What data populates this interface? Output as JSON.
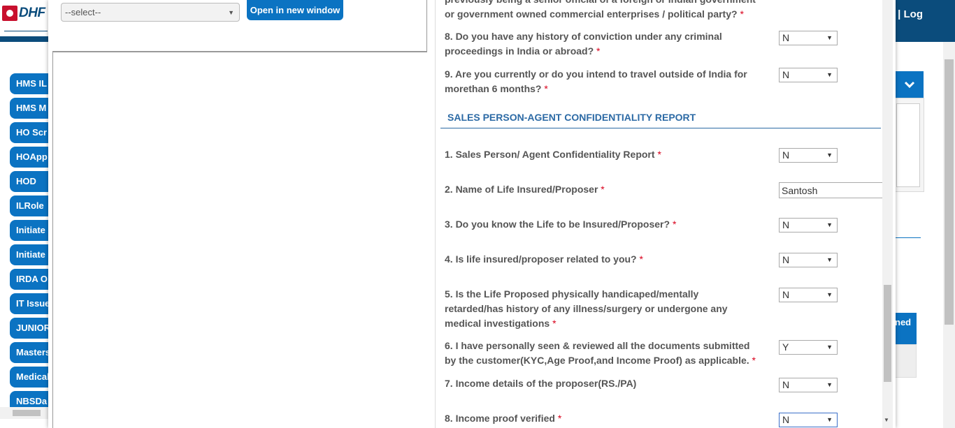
{
  "app": {
    "logo_text": "DHF",
    "logout_label": "| Log"
  },
  "sidebar": {
    "items": [
      {
        "label": "HMS IL"
      },
      {
        "label": "HMS M"
      },
      {
        "label": "HO Scr"
      },
      {
        "label": "HOApp"
      },
      {
        "label": "HOD"
      },
      {
        "label": "ILRole"
      },
      {
        "label": "Initiate"
      },
      {
        "label": "Initiate"
      },
      {
        "label": "IRDA O"
      },
      {
        "label": "IT Issue"
      },
      {
        "label": "JUNIOR"
      },
      {
        "label": "Masters"
      },
      {
        "label": "Medical"
      },
      {
        "label": "NBSDa"
      }
    ]
  },
  "right_panel": {
    "chevron_icon": "chevron-down-icon",
    "button2_label": "ned"
  },
  "document_viewer": {
    "select_value": "--select--",
    "open_button_label": "Open in new window"
  },
  "form": {
    "partial_question": {
      "line1": "previously being a senior official of a foreign or Indian government",
      "line2": "or government owned commercial enterprises / political party?"
    },
    "questions_top": [
      {
        "text_line1": "8. Do you have any history of conviction under any criminal",
        "text_line2": "proceedings in India or abroad?",
        "value": "N"
      },
      {
        "text_line1": "9. Are you currently or do you intend to travel outside of India for",
        "text_line2": "morethan 6 months?",
        "value": "N"
      }
    ],
    "section_title": "SALES PERSON-AGENT CONFIDENTIALITY REPORT",
    "sales_questions": [
      {
        "text": "1. Sales Person/ Agent Confidentiality Report",
        "required": true,
        "value": "N"
      },
      {
        "text": "2. Name of Life Insured/Proposer",
        "required": true,
        "value": "Santosh"
      },
      {
        "text": "3. Do you know the Life to be Insured/Proposer?",
        "required": true,
        "value": "N"
      },
      {
        "text": "4. Is life insured/proposer related to you?",
        "required": true,
        "value": "N"
      },
      {
        "text_line1": "5. Is the Life Proposed physically handicaped/mentally",
        "text_line2": "retarded/has history of any illness/surgery or undergone any",
        "text_line3": "medical investigations",
        "required": true,
        "value": "N"
      },
      {
        "text_line1": "6. I have personally seen & reviewed all the documents submitted",
        "text_line2": "by the customer(KYC,Age Proof,and Income Proof) as applicable.",
        "required": true,
        "value": "Y"
      },
      {
        "text": "7. Income details of the proposer(RS./PA)",
        "required": false,
        "value": "N"
      },
      {
        "text": "8. Income proof verified",
        "required": true,
        "value": "N"
      }
    ],
    "required_marker": "*"
  }
}
